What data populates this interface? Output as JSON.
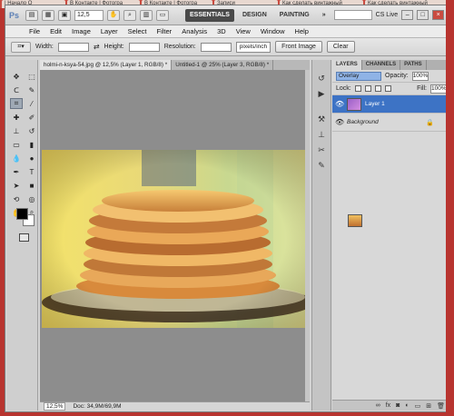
{
  "browser_tabs": [
    {
      "label": "| Начало О"
    },
    {
      "label": "В Контакте | Фотогра"
    },
    {
      "label": "В Контакте | Фотогра"
    },
    {
      "label": "Записи"
    },
    {
      "label": "Как сделать винтажный"
    },
    {
      "label": "Как сделать винтажный"
    }
  ],
  "appbar": {
    "logo": "Ps",
    "zoom": "12,5",
    "workspaces": [
      {
        "label": "ESSENTIALS",
        "active": true
      },
      {
        "label": "DESIGN"
      },
      {
        "label": "PAINTING"
      },
      {
        "label": "»"
      }
    ],
    "cslive": "CS Live",
    "win_min": "–",
    "win_max": "□",
    "win_close": "×"
  },
  "menu": [
    "File",
    "Edit",
    "Image",
    "Layer",
    "Select",
    "Filter",
    "Analysis",
    "3D",
    "View",
    "Window",
    "Help"
  ],
  "options": {
    "width_label": "Width:",
    "height_label": "Height:",
    "resolution_label": "Resolution:",
    "unit": "pixels/inch",
    "front_image": "Front Image",
    "clear": "Clear"
  },
  "document_tabs": [
    {
      "label": "holmi-n-ksya-54.jpg @ 12,5% (Layer 1, RGB/8) *",
      "active": true
    },
    {
      "label": "Untitled-1 @ 25% (Layer 3, RGB/8) *",
      "active": false
    }
  ],
  "status": {
    "zoom": "12,5%",
    "doc": "Doc: 34,9M/69,9M"
  },
  "layers_panel": {
    "tabs": [
      "LAYERS",
      "CHANNELS",
      "PATHS"
    ],
    "blend_mode": "Overlay",
    "opacity_label": "Opacity:",
    "opacity_value": "100%",
    "lock_label": "Lock:",
    "fill_label": "Fill:",
    "fill_value": "100%",
    "layers": [
      {
        "name": "Layer 1",
        "selected": true
      },
      {
        "name": "Background",
        "selected": false
      }
    ]
  },
  "colors": {
    "accent": "#3d73c5",
    "workspace_active": "#4a4a4a",
    "desktop": "#b8342f"
  }
}
